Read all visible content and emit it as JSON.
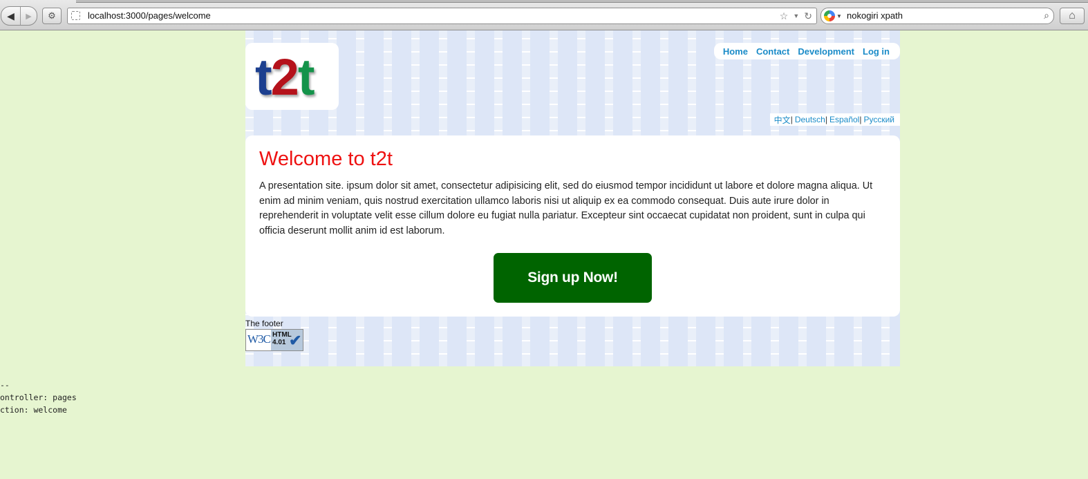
{
  "browser": {
    "url": "localhost:3000/pages/welcome",
    "search_query": "nokogiri xpath",
    "icons": {
      "back": "back-arrow-icon",
      "forward": "forward-arrow-icon",
      "tools": "gear-icon",
      "page": "page-icon",
      "bookmark": "star-icon",
      "reload": "reload-icon",
      "search_engine": "google-icon",
      "search": "magnifier-icon",
      "home": "home-icon"
    }
  },
  "site": {
    "logo": [
      "t",
      "2",
      "t"
    ],
    "nav": [
      "Home",
      "Contact",
      "Development",
      "Log in"
    ],
    "languages": [
      "中文",
      "Deutsch",
      "Español",
      "Русский"
    ],
    "heading": "Welcome to t2t",
    "body": "A presentation site. ipsum dolor sit amet, consectetur adipisicing elit, sed do eiusmod tempor incididunt ut labore et dolore magna aliqua. Ut enim ad minim veniam, quis nostrud exercitation ullamco laboris nisi ut aliquip ex ea commodo consequat. Duis aute irure dolor in reprehenderit in voluptate velit esse cillum dolore eu fugiat nulla pariatur. Excepteur sint occaecat cupidatat non proident, sunt in culpa qui officia deserunt mollit anim id est laborum.",
    "signup_label": "Sign up Now!",
    "footer": "The footer",
    "badge": {
      "mark": "W3C",
      "line1": "HTML",
      "line2": "4.01"
    }
  },
  "debug": [
    "--",
    "ontroller: pages",
    "ction: welcome"
  ],
  "colors": {
    "page_bg": "#e6f5d0",
    "link": "#1a8bc8",
    "heading": "#ee1111",
    "signup_bg": "#006400",
    "logo_t": "#1c3f8f",
    "logo_2": "#b5121b",
    "logo_t2": "#14934a"
  }
}
